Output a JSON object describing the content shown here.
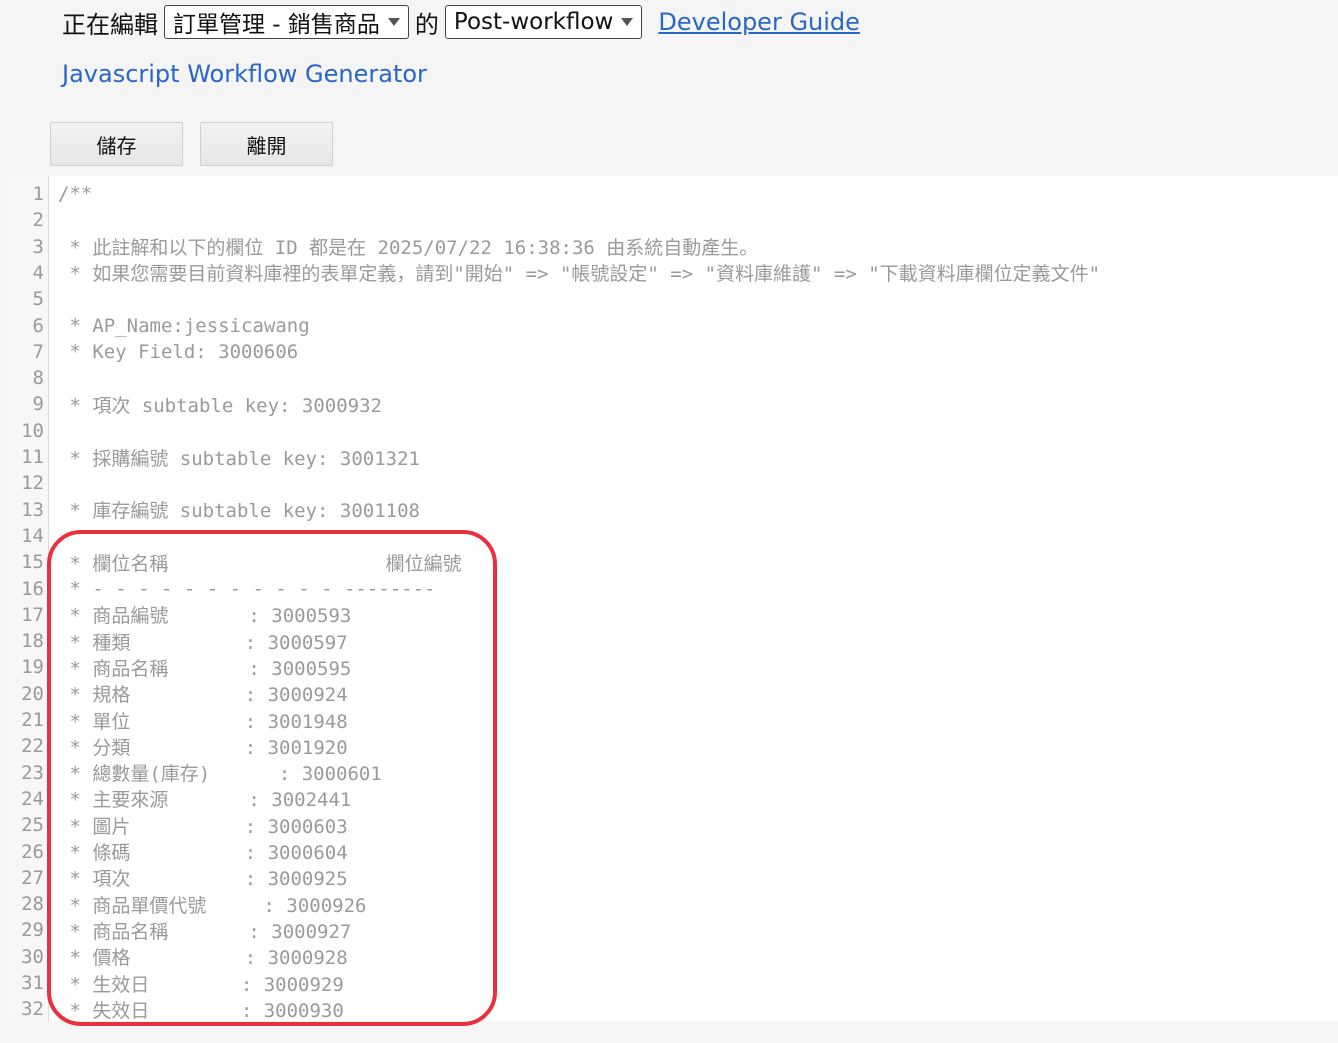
{
  "header": {
    "editing_label": "正在編輯",
    "form_select": "訂單管理 - 銷售商品",
    "of_label": "的",
    "workflow_select": "Post-workflow",
    "developer_guide": "Developer Guide",
    "generator_link": "Javascript Workflow Generator"
  },
  "buttons": {
    "save": "儲存",
    "leave": "離開"
  },
  "editor": {
    "lines": [
      {
        "n": "1",
        "text": "/**"
      },
      {
        "n": "2",
        "text": ""
      },
      {
        "n": "3",
        "text": " * 此註解和以下的欄位 ID 都是在 2025/07/22 16:38:36 由系統自動產生。"
      },
      {
        "n": "4",
        "text": " * 如果您需要目前資料庫裡的表單定義，請到\"開始\" => \"帳號設定\" => \"資料庫維護\" => \"下載資料庫欄位定義文件\""
      },
      {
        "n": "5",
        "text": ""
      },
      {
        "n": "6",
        "text": " * AP_Name:jessicawang"
      },
      {
        "n": "7",
        "text": " * Key Field: 3000606"
      },
      {
        "n": "8",
        "text": ""
      },
      {
        "n": "9",
        "text": " * 項次 subtable key: 3000932"
      },
      {
        "n": "10",
        "text": ""
      },
      {
        "n": "11",
        "text": " * 採購編號 subtable key: 3001321"
      },
      {
        "n": "12",
        "text": ""
      },
      {
        "n": "13",
        "text": " * 庫存編號 subtable key: 3001108"
      },
      {
        "n": "14",
        "text": ""
      },
      {
        "n": "15",
        "text": " * 欄位名稱                   欄位編號"
      },
      {
        "n": "16",
        "text": " * - - - - - - - - - - - --------"
      },
      {
        "n": "17",
        "text": " * 商品編號       : 3000593"
      },
      {
        "n": "18",
        "text": " * 種類          : 3000597"
      },
      {
        "n": "19",
        "text": " * 商品名稱       : 3000595"
      },
      {
        "n": "20",
        "text": " * 規格          : 3000924"
      },
      {
        "n": "21",
        "text": " * 單位          : 3001948"
      },
      {
        "n": "22",
        "text": " * 分類          : 3001920"
      },
      {
        "n": "23",
        "text": " * 總數量(庫存)      : 3000601"
      },
      {
        "n": "24",
        "text": " * 主要來源       : 3002441"
      },
      {
        "n": "25",
        "text": " * 圖片          : 3000603"
      },
      {
        "n": "26",
        "text": " * 條碼          : 3000604"
      },
      {
        "n": "27",
        "text": " * 項次          : 3000925"
      },
      {
        "n": "28",
        "text": " * 商品單價代號     : 3000926"
      },
      {
        "n": "29",
        "text": " * 商品名稱       : 3000927"
      },
      {
        "n": "30",
        "text": " * 價格          : 3000928"
      },
      {
        "n": "31",
        "text": " * 生效日        : 3000929"
      },
      {
        "n": "32",
        "text": " * 失效日        : 3000930"
      }
    ]
  }
}
